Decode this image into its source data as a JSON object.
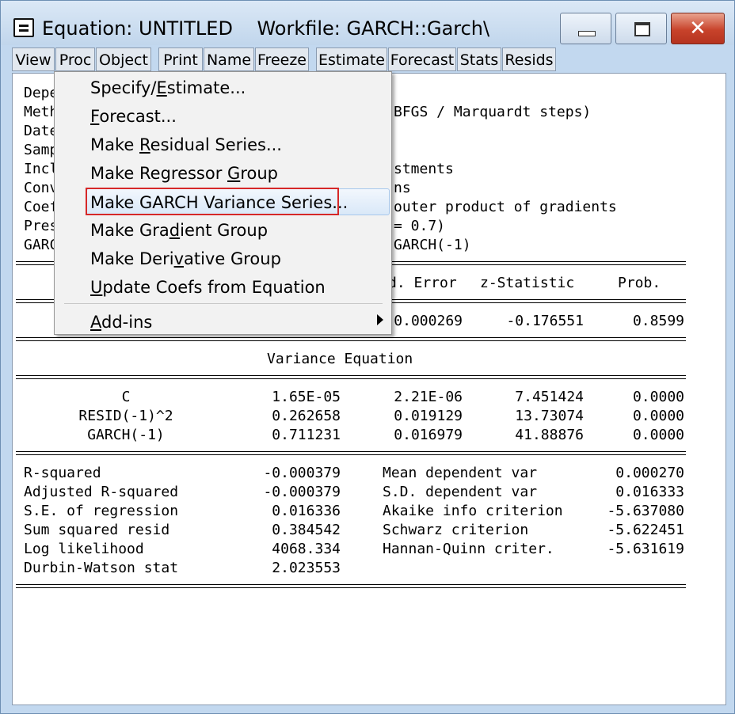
{
  "window": {
    "title": "Equation: UNTITLED    Workfile: GARCH::Garch\\",
    "minimize_icon": "minimize-icon",
    "maximize_icon": "maximize-icon",
    "close_icon": "close-icon"
  },
  "toolbar": [
    "View",
    "Proc",
    "Object",
    "Print",
    "Name",
    "Freeze",
    "Estimate",
    "Forecast",
    "Stats",
    "Resids"
  ],
  "header_lines": {
    "dep": "Depe",
    "method": "Meth",
    "method_tail": "BFGS / Marquardt steps)",
    "date": "Date",
    "sample": "Samp",
    "included": "Incl",
    "included_tail": "stments",
    "convergence": "Conv",
    "convergence_tail": "ns",
    "coef": "Coef",
    "coef_tail": "outer product of gradients",
    "presample": "Pres",
    "presample_tail": "= 0.7)",
    "garch": "GARC",
    "garch_tail": "GARCH(-1)"
  },
  "table_header": {
    "stderr": "d. Error",
    "zstat": "z-Statistic",
    "prob": "Prob."
  },
  "mean_row": {
    "stderr": "0.000269",
    "zstat": "-0.176551",
    "prob": "0.8599"
  },
  "variance_title": "Variance Equation",
  "variance_rows": [
    {
      "var": "C",
      "coef": "1.65E-05",
      "stderr": "2.21E-06",
      "zstat": "7.451424",
      "prob": "0.0000"
    },
    {
      "var": "RESID(-1)^2",
      "coef": "0.262658",
      "stderr": "0.019129",
      "zstat": "13.73074",
      "prob": "0.0000"
    },
    {
      "var": "GARCH(-1)",
      "coef": "0.711231",
      "stderr": "0.016979",
      "zstat": "41.88876",
      "prob": "0.0000"
    }
  ],
  "stats_left": [
    {
      "label": "R-squared",
      "value": "-0.000379"
    },
    {
      "label": "Adjusted R-squared",
      "value": "-0.000379"
    },
    {
      "label": "S.E. of regression",
      "value": "0.016336"
    },
    {
      "label": "Sum squared resid",
      "value": "0.384542"
    },
    {
      "label": "Log likelihood",
      "value": "4068.334"
    },
    {
      "label": "Durbin-Watson stat",
      "value": "2.023553"
    }
  ],
  "stats_right": [
    {
      "label": "Mean dependent var",
      "value": "0.000270"
    },
    {
      "label": "S.D. dependent var",
      "value": "0.016333"
    },
    {
      "label": "Akaike info criterion",
      "value": "-5.637080"
    },
    {
      "label": "Schwarz criterion",
      "value": "-5.622451"
    },
    {
      "label": "Hannan-Quinn criter.",
      "value": "-5.631619"
    }
  ],
  "menu": {
    "items": [
      {
        "pre": "Specify/",
        "acc": "E",
        "post": "stimate..."
      },
      {
        "pre": "",
        "acc": "F",
        "post": "orecast..."
      },
      {
        "pre": "Make ",
        "acc": "R",
        "post": "esidual Series..."
      },
      {
        "pre": "Make Regressor ",
        "acc": "G",
        "post": "roup"
      },
      {
        "pre": "Make GARCH Variance Series...",
        "acc": "",
        "post": ""
      },
      {
        "pre": "Make Gra",
        "acc": "d",
        "post": "ient Group"
      },
      {
        "pre": "Make Deri",
        "acc": "v",
        "post": "ative Group"
      },
      {
        "pre": "",
        "acc": "U",
        "post": "pdate Coefs from Equation"
      }
    ],
    "addins": {
      "pre": "",
      "acc": "A",
      "post": "dd-ins"
    },
    "submenu_icon": "submenu-arrow-icon"
  }
}
